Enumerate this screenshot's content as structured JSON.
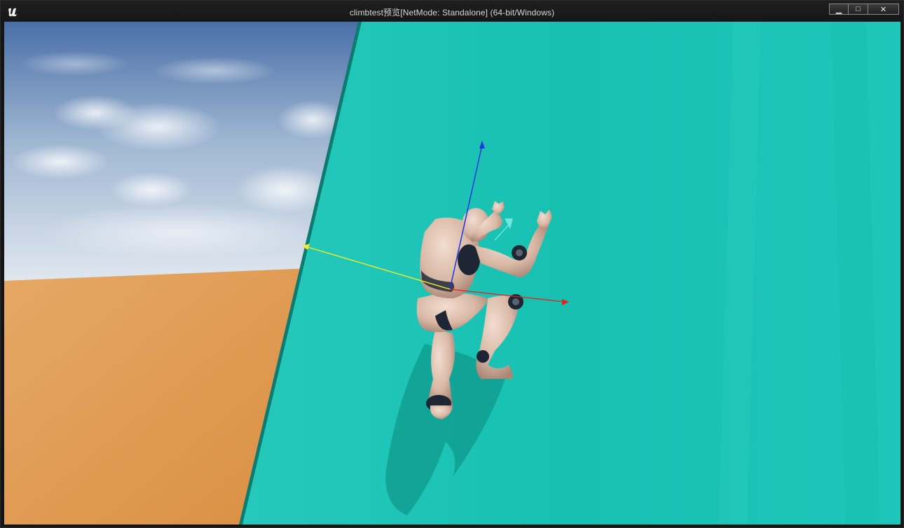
{
  "window": {
    "title": "climbtest预览[NetMode: Standalone]  (64-bit/Windows)",
    "minimize_glyph": "▁",
    "maximize_glyph": "□",
    "close_glyph": "✕",
    "logo_icon": "unreal-engine-logo-icon"
  },
  "scene": {
    "sky_colors": [
      "#4a6fa8",
      "#dfe6ee"
    ],
    "ground_color": "#e0a25f",
    "wall_color": "#1dc3b5",
    "axis_colors": {
      "forward": "#e8201c",
      "up": "#1736e0",
      "right": "#f4ea2a"
    }
  }
}
